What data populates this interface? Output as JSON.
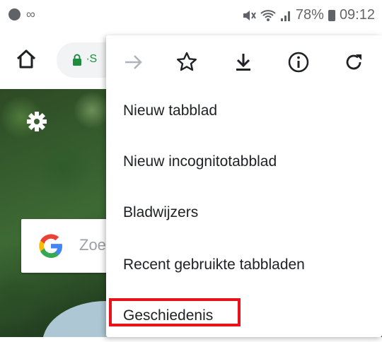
{
  "status_bar": {
    "battery": "78%",
    "time": "09:12",
    "left_icons": [
      "notification-dot-icon",
      "infinity-icon"
    ],
    "right_icons": [
      "mute-icon",
      "wifi-icon",
      "signal-icon",
      "battery-icon"
    ]
  },
  "toolbar": {
    "omnibox_text": "∙S"
  },
  "menu": {
    "icons": [
      "forward-icon",
      "bookmark-star-icon",
      "download-icon",
      "info-icon",
      "reload-icon"
    ],
    "items": [
      {
        "label": "Nieuw tabblad"
      },
      {
        "label": "Nieuw incognitotabblad"
      },
      {
        "label": "Bladwijzers"
      },
      {
        "label": "Recent gebruikte tabbladen"
      },
      {
        "label": "Geschiedenis"
      }
    ]
  },
  "ntp": {
    "search_placeholder": "Zoe"
  },
  "colors": {
    "highlight": "#e8121a",
    "lock_green": "#1e8e3e"
  }
}
